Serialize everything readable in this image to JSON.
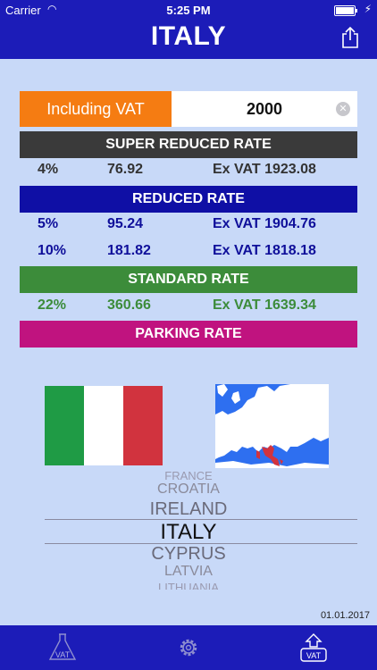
{
  "status": {
    "carrier": "Carrier",
    "time": "5:25 PM"
  },
  "header": {
    "title": "ITALY"
  },
  "calculator": {
    "mode_label": "Including VAT",
    "amount": "2000",
    "clear_symbol": "✕"
  },
  "rates": {
    "super_reduced": {
      "label": "SUPER REDUCED RATE",
      "color": "#3a3a3a",
      "rows": [
        {
          "pct": "4%",
          "vat": "76.92",
          "ex": "Ex VAT 1923.08",
          "color": "#333333"
        }
      ]
    },
    "reduced": {
      "label": "REDUCED RATE",
      "color": "#0f0fa5",
      "rows": [
        {
          "pct": "5%",
          "vat": "95.24",
          "ex": "Ex VAT 1904.76",
          "color": "#0f0f9a"
        },
        {
          "pct": "10%",
          "vat": "181.82",
          "ex": "Ex VAT 1818.18",
          "color": "#0f0f9a"
        }
      ]
    },
    "standard": {
      "label": "STANDARD RATE",
      "color": "#3c8c3a",
      "rows": [
        {
          "pct": "22%",
          "vat": "360.66",
          "ex": "Ex VAT 1639.34",
          "color": "#3c8c3a"
        }
      ]
    },
    "parking": {
      "label": "PARKING RATE",
      "color": "#c0137f"
    }
  },
  "flag_colors": [
    "#1f9b45",
    "#ffffff",
    "#d1333e"
  ],
  "picker": {
    "items": [
      "FRANCE",
      "CROATIA",
      "IRELAND",
      "ITALY",
      "CYPRUS",
      "LATVIA",
      "LITHUANIA"
    ],
    "selected": "ITALY"
  },
  "footer": {
    "date": "01.01.2017"
  },
  "tabs": {
    "left_label": "VAT",
    "right_label": "VAT"
  },
  "icons": {
    "share": "share-icon",
    "gear": "gear-icon",
    "vat_flask": "flask-vat-icon",
    "vat_upload": "upload-vat-icon"
  }
}
